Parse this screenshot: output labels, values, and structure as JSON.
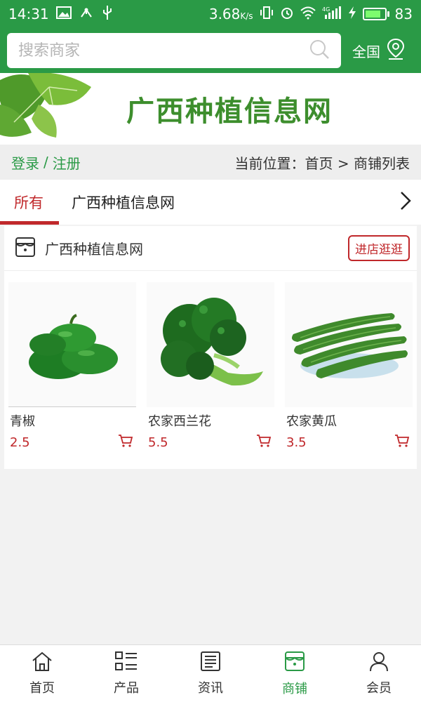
{
  "status_bar": {
    "time": "14:31",
    "speed": "3.68",
    "speed_unit": "K/s",
    "network": "4G",
    "battery": "83",
    "battery_level": 0.83
  },
  "header": {
    "search_placeholder": "搜索商家",
    "region_label": "全国"
  },
  "banner": {
    "title": "广西种植信息网"
  },
  "breadcrumb": {
    "login": "登录",
    "separator": "/",
    "register": "注册",
    "position": "当前位置：首页 > 商铺列表"
  },
  "tabs": [
    {
      "label": "所有",
      "active": true
    },
    {
      "label": "广西种植信息网",
      "active": false
    }
  ],
  "store": {
    "name": "广西种植信息网",
    "visit_label": "进店逛逛",
    "products": [
      {
        "name": "青椒",
        "price": "2.5"
      },
      {
        "name": "农家西兰花",
        "price": "5.5"
      },
      {
        "name": "农家黄瓜",
        "price": "3.5"
      }
    ]
  },
  "bottom_nav": [
    {
      "label": "首页",
      "icon": "home-icon",
      "active": false
    },
    {
      "label": "产品",
      "icon": "grid-list-icon",
      "active": false
    },
    {
      "label": "资讯",
      "icon": "news-icon",
      "active": false
    },
    {
      "label": "商铺",
      "icon": "store-icon",
      "active": true
    },
    {
      "label": "会员",
      "icon": "user-icon",
      "active": false
    }
  ],
  "colors": {
    "brand_green": "#2a9a46",
    "accent_red": "#c0282b"
  }
}
